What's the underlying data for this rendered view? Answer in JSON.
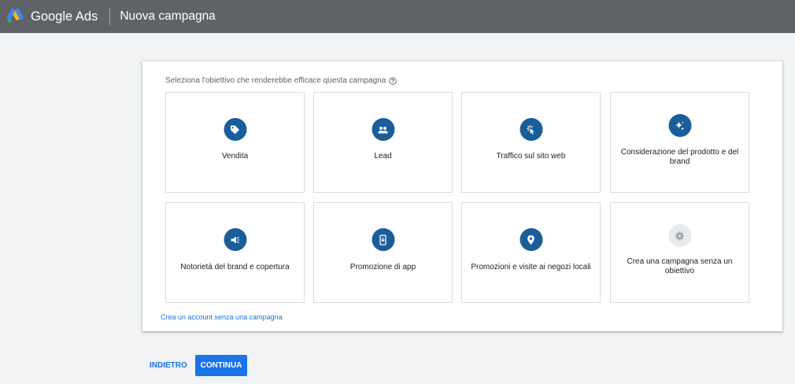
{
  "header": {
    "brand": "Google Ads",
    "title": "Nuova campagna",
    "background": "#5f6368"
  },
  "card": {
    "prompt": "Seleziona l'obiettivo che renderebbe efficace questa campagna",
    "tiles": [
      {
        "label": "Vendita",
        "icon": "tag-icon"
      },
      {
        "label": "Lead",
        "icon": "people-icon"
      },
      {
        "label": "Traffico sul sito web",
        "icon": "cursor-click-icon"
      },
      {
        "label": "Considerazione del prodotto e del brand",
        "icon": "sparkle-icon"
      },
      {
        "label": "Notorietà del brand e copertura",
        "icon": "megaphone-icon"
      },
      {
        "label": "Promozione di app",
        "icon": "phone-download-icon"
      },
      {
        "label": "Promozioni e visite ai negozi locali",
        "icon": "location-pin-icon"
      },
      {
        "label": "Crea una campagna senza un obiettivo",
        "icon": "gear-icon"
      }
    ],
    "link": "Crea un account senza una campagna"
  },
  "footer": {
    "back_label": "INDIETRO",
    "continue_label": "CONTINUA"
  },
  "colors": {
    "accent": "#1a73e8",
    "icon_bg": "#1a5d9b"
  }
}
